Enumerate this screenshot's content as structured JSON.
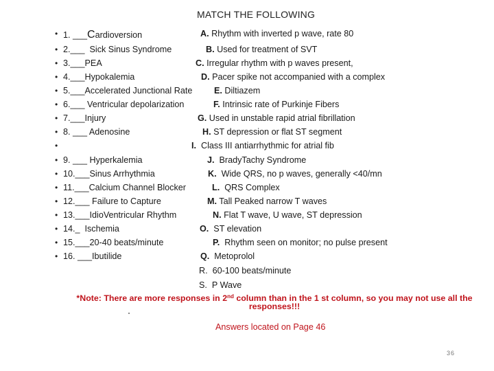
{
  "title": "MATCH THE FOLLOWING",
  "bullet_glyph": "•",
  "rows": [
    {
      "left": "1. ___",
      "left_big": "C",
      "left_rest": "ardioversion",
      "right_letter": "A.",
      "right_text": " Rhythm with inverted p wave, rate 80"
    },
    {
      "left": "2.___  Sick Sinus Syndrome",
      "right_letter": "B.",
      "right_text": " Used for treatment of SVT"
    },
    {
      "left": "3.___PEA",
      "right_letter": "C.",
      "right_text": " Irregular rhythm with p waves present,"
    },
    {
      "left": "4.___Hypokalemia",
      "right_letter": "D.",
      "right_text": " Pacer spike not accompanied with a complex"
    },
    {
      "left": "5.___Accelerated Junctional Rate",
      "right_letter": "E.",
      "right_text": " Diltiazem"
    },
    {
      "left": "6.___ Ventricular depolarization",
      "right_letter": "F.",
      "right_text": " Intrinsic rate of Purkinje Fibers"
    },
    {
      "left": "7.___Injury",
      "right_letter": "G.",
      "right_text": " Used in unstable rapid atrial fibrillation"
    },
    {
      "left": "8. ___ Adenosine",
      "right_letter": "H.",
      "right_text": " ST depression or flat ST segment"
    },
    {
      "left": "",
      "right_letter": "I.",
      "right_text": "  Class III antiarrhythmic for atrial fib"
    },
    {
      "left": "9. ___ Hyperkalemia",
      "right_letter": "J.",
      "right_text": "  BradyTachy Syndrome"
    },
    {
      "left": "10.___Sinus Arrhythmia",
      "right_letter": "K.",
      "right_text": "  Wide QRS, no p waves, generally <40/mn"
    },
    {
      "left": "11.___Calcium Channel Blocker",
      "right_letter": "L.",
      "right_text": "  QRS Complex"
    },
    {
      "left": "12.___ Failure to Capture",
      "right_letter": "M.",
      "right_text": " Tall Peaked narrow T waves"
    },
    {
      "left": "13.___IdioVentricular Rhythm",
      "right_letter": "N.",
      "right_text": " Flat T wave, U wave, ST depression"
    },
    {
      "left": "14._  Ischemia",
      "right_letter": "O.",
      "right_text": "  ST elevation"
    },
    {
      "left": "15.___20-40 beats/minute",
      "right_letter": "P.",
      "right_text": "  Rhythm seen on monitor; no pulse present"
    },
    {
      "left": "16. ___Ibutilide",
      "right_letter": "Q.",
      "right_text": "  Metoprolol"
    }
  ],
  "extra_responses": [
    {
      "right_letter": "R.",
      "right_text": "  60-100 beats/minute"
    },
    {
      "right_letter": "S.",
      "right_text": "  P Wave"
    }
  ],
  "note": {
    "prefix": "*Note:  There are more responses in 2",
    "sup": "nd",
    "suffix": " column than in the 1 st column, so you may not use all the responses!!!"
  },
  "answers": "Answers located on Page 46",
  "page_number": "36",
  "colors": {
    "note_red": "#c0141c",
    "text": "#1a1a1a"
  }
}
